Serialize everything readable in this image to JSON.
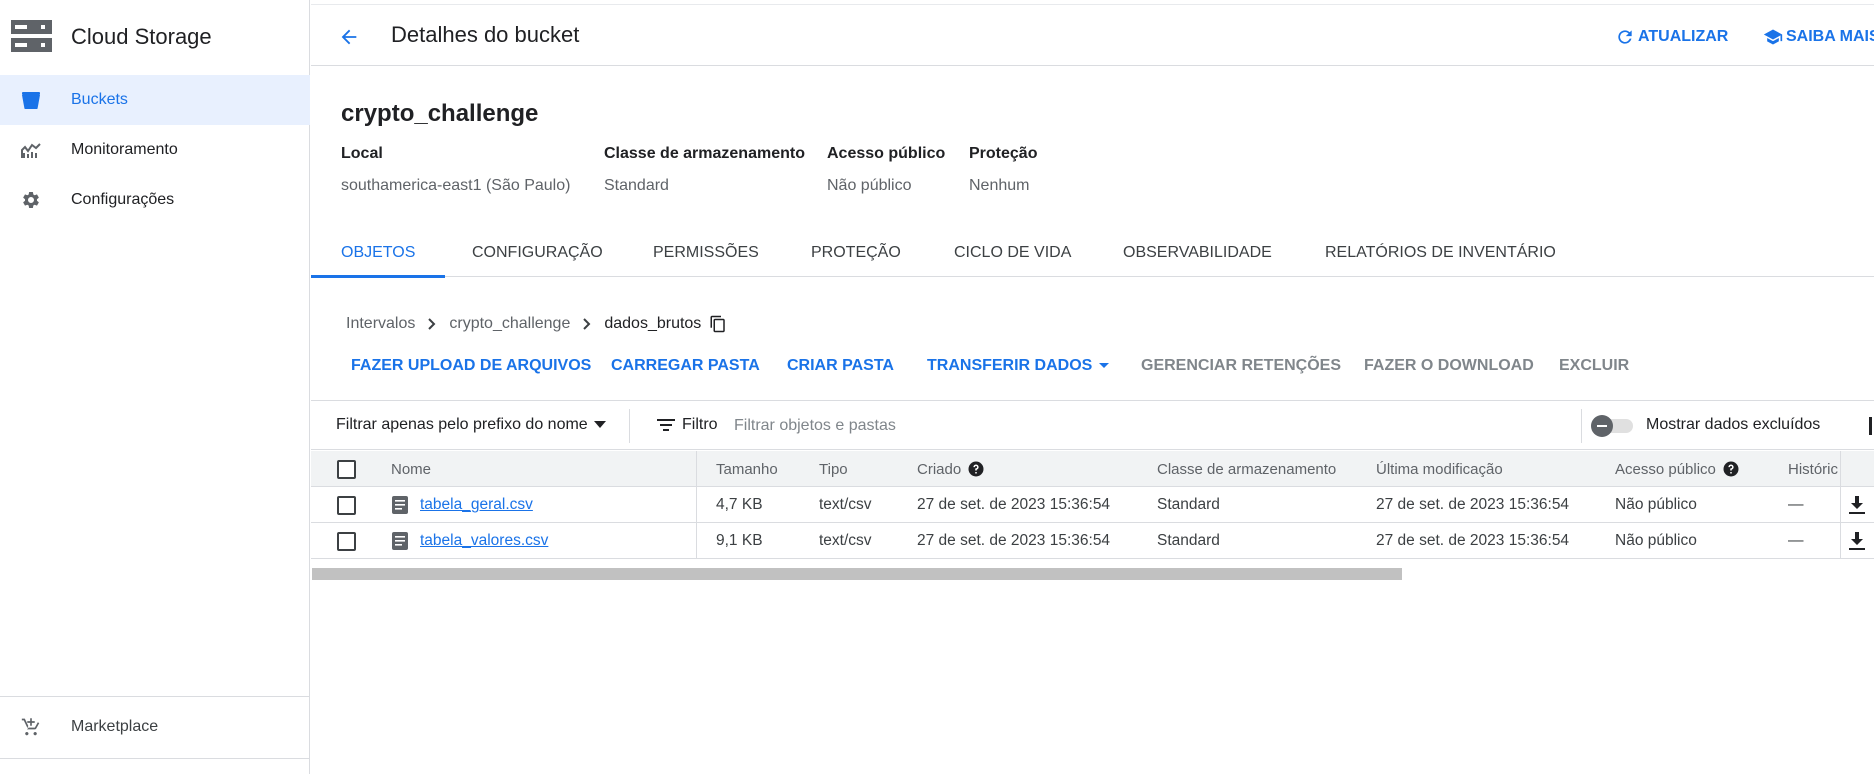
{
  "app": {
    "name": "Cloud Storage"
  },
  "sidebar": {
    "items": [
      {
        "label": "Buckets",
        "icon": "bucket-icon",
        "active": true
      },
      {
        "label": "Monitoramento",
        "icon": "monitoring-icon",
        "active": false
      },
      {
        "label": "Configurações",
        "icon": "gear-icon",
        "active": false
      }
    ],
    "bottom": {
      "label": "Marketplace",
      "icon": "marketplace-icon"
    }
  },
  "header": {
    "title": "Detalhes do bucket",
    "refresh_label": "ATUALIZAR",
    "learn_label": "SAIBA MAIS"
  },
  "bucket": {
    "name": "crypto_challenge",
    "meta": {
      "local_label": "Local",
      "local_value": "southamerica-east1 (São Paulo)",
      "class_label": "Classe de armazenamento",
      "class_value": "Standard",
      "access_label": "Acesso público",
      "access_value": "Não público",
      "protection_label": "Proteção",
      "protection_value": "Nenhum"
    }
  },
  "tabs": [
    {
      "label": "OBJETOS",
      "active": true
    },
    {
      "label": "CONFIGURAÇÃO"
    },
    {
      "label": "PERMISSÕES"
    },
    {
      "label": "PROTEÇÃO"
    },
    {
      "label": "CICLO DE VIDA"
    },
    {
      "label": "OBSERVABILIDADE"
    },
    {
      "label": "RELATÓRIOS DE INVENTÁRIO"
    }
  ],
  "breadcrumb": {
    "root": "Intervalos",
    "bucket": "crypto_challenge",
    "current": "dados_brutos"
  },
  "toolbar": {
    "upload_files": "FAZER UPLOAD DE ARQUIVOS",
    "upload_folder": "CARREGAR PASTA",
    "create_folder": "CRIAR PASTA",
    "transfer": "TRANSFERIR DADOS",
    "manage_retention": "GERENCIAR RETENÇÕES",
    "download": "FAZER O DOWNLOAD",
    "delete": "EXCLUIR"
  },
  "filter": {
    "prefix_label": "Filtrar apenas pelo prefixo do nome",
    "filter_label": "Filtro",
    "placeholder": "Filtrar objetos e pastas",
    "show_deleted_label": "Mostrar dados excluídos"
  },
  "table": {
    "columns": {
      "name": "Nome",
      "size": "Tamanho",
      "type": "Tipo",
      "created": "Criado",
      "storage_class": "Classe de armazenamento",
      "modified": "Última modificação",
      "public_access": "Acesso público",
      "history": "Históric"
    },
    "rows": [
      {
        "name": "tabela_geral.csv",
        "size": "4,7 KB",
        "type": "text/csv",
        "created": "27 de set. de 2023 15:36:54",
        "storage_class": "Standard",
        "modified": "27 de set. de 2023 15:36:54",
        "public_access": "Não público",
        "history": "—"
      },
      {
        "name": "tabela_valores.csv",
        "size": "9,1 KB",
        "type": "text/csv",
        "created": "27 de set. de 2023 15:36:54",
        "storage_class": "Standard",
        "modified": "27 de set. de 2023 15:36:54",
        "public_access": "Não público",
        "history": "—"
      }
    ]
  },
  "colors": {
    "accent": "#1a73e8",
    "active_bg": "#e8f0fe",
    "border": "#dadce0"
  }
}
